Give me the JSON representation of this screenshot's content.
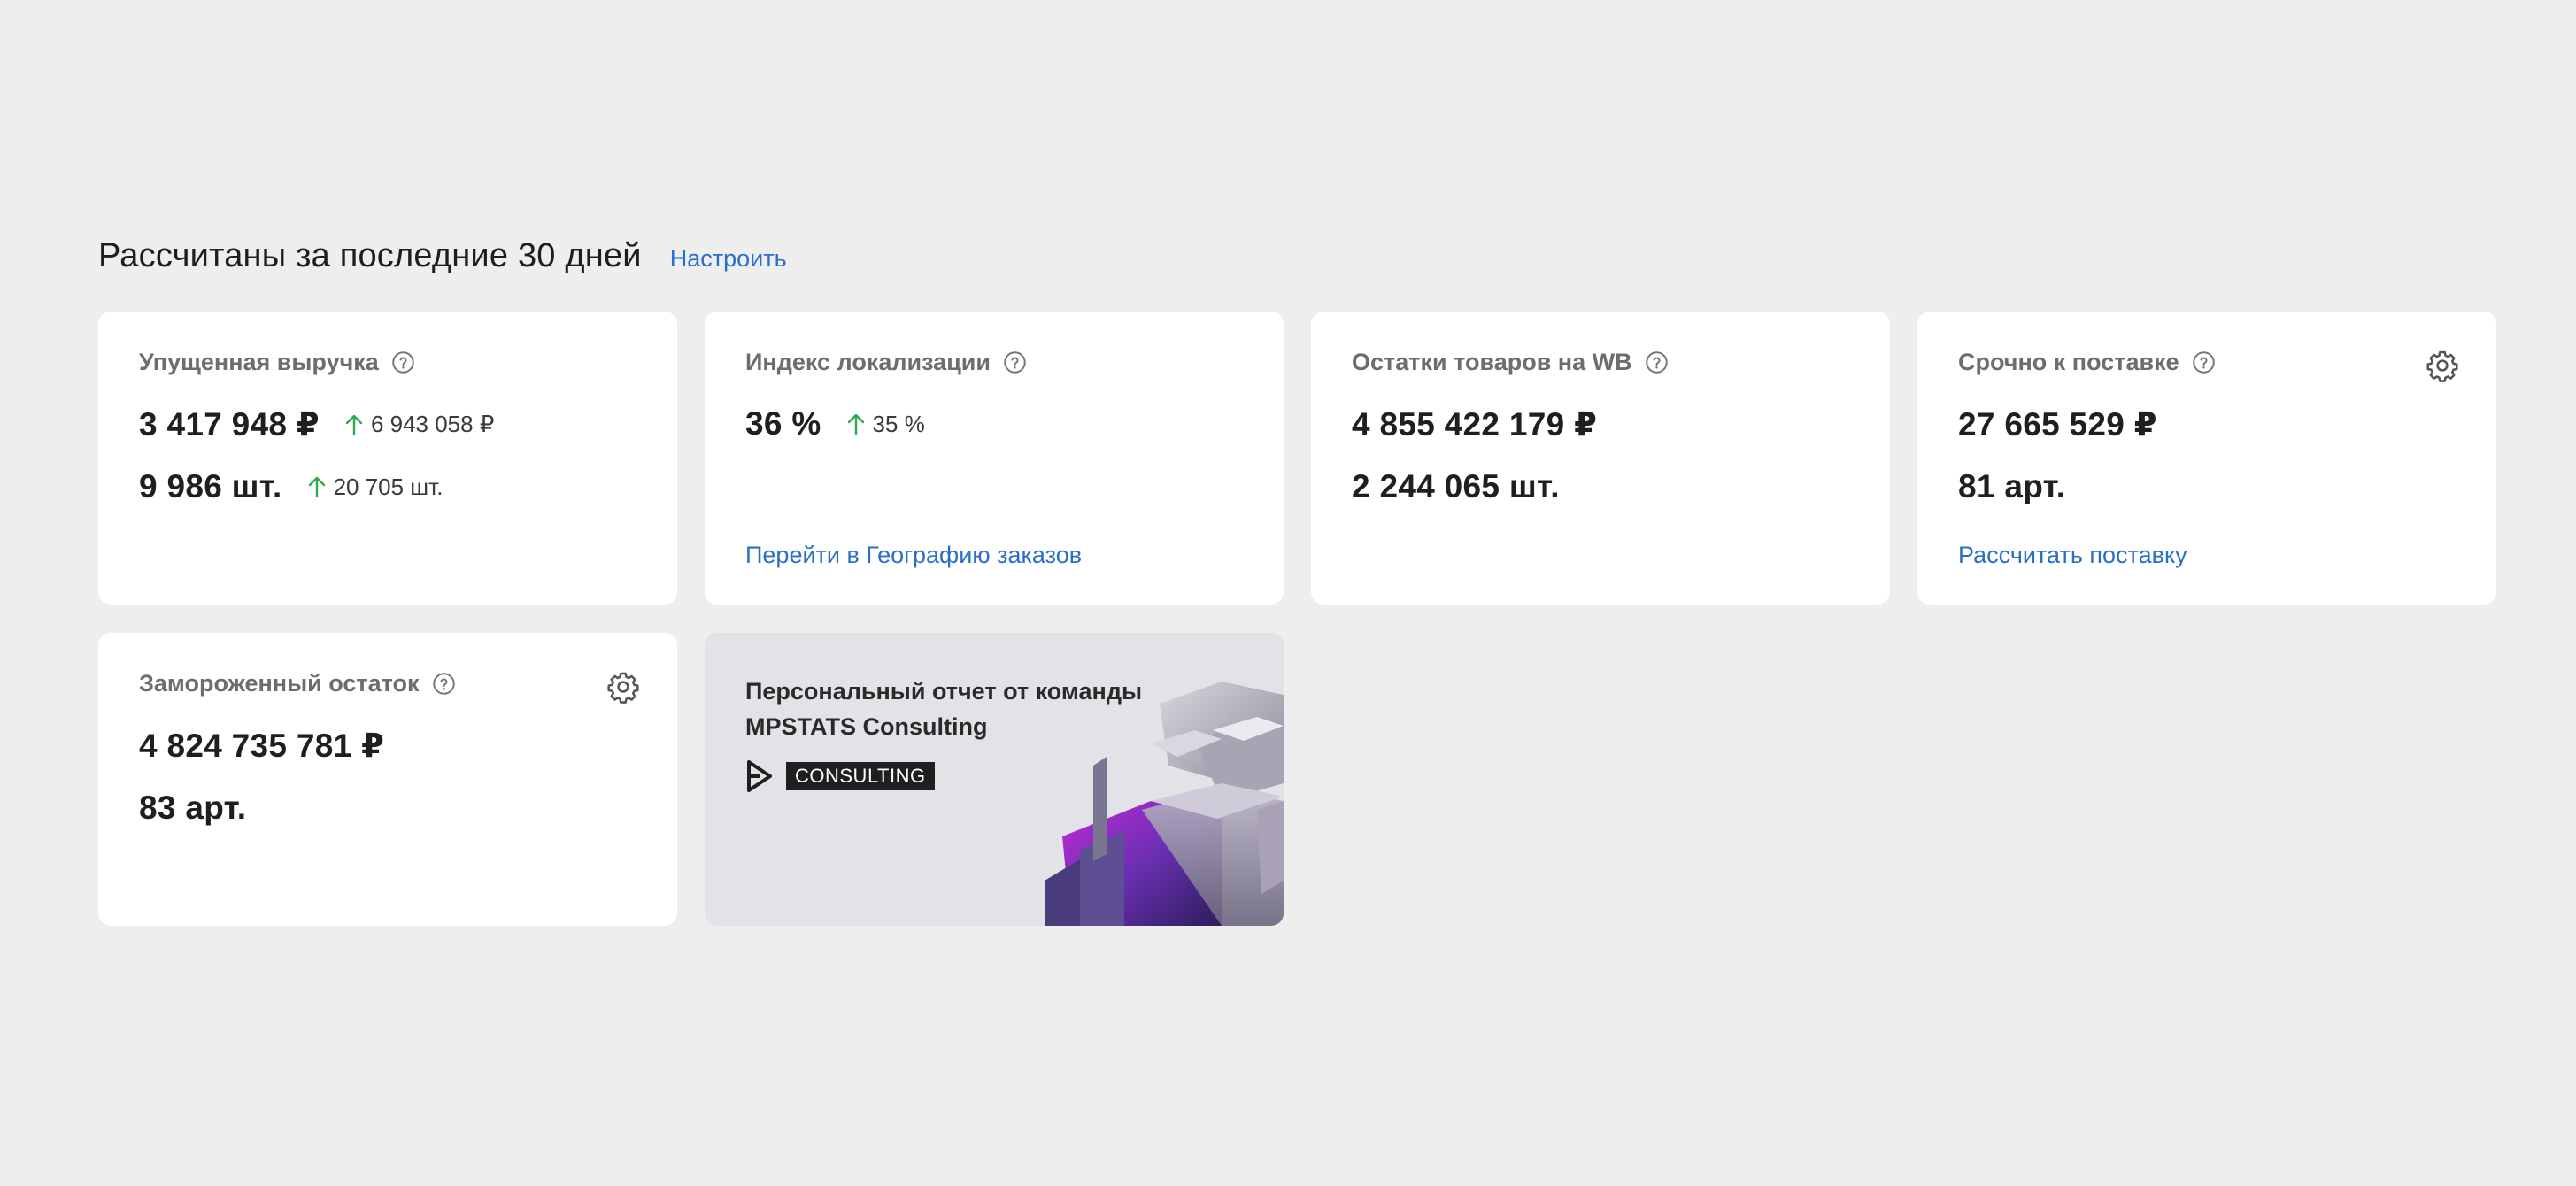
{
  "header": {
    "title": "Рассчитаны за последние 30 дней",
    "configure_link": "Настроить"
  },
  "cards": {
    "lost_revenue": {
      "title": "Упущенная выручка",
      "value_rub": "3 417 948 ₽",
      "delta_rub": "6 943 058 ₽",
      "value_units": "9 986 шт.",
      "delta_units": "20 705 шт.",
      "delta_color": "#2eaa4f"
    },
    "localization_index": {
      "title": "Индекс локализации",
      "value": "36 %",
      "delta": "35 %",
      "link": "Перейти в Географию заказов"
    },
    "wb_stock": {
      "title": "Остатки товаров на WB",
      "value_rub": "4 855 422 179 ₽",
      "value_units": "2 244 065 шт."
    },
    "urgent_supply": {
      "title": "Срочно к поставке",
      "value_rub": "27 665 529 ₽",
      "value_articles": "81 арт.",
      "link": "Рассчитать поставку"
    },
    "frozen_stock": {
      "title": "Замороженный остаток",
      "value_rub": "4 824 735 781 ₽",
      "value_articles": "83 арт."
    },
    "promo": {
      "line1": "Персональный отчет от команды",
      "line2": "MPSTATS Consulting",
      "badge": "CONSULTING"
    }
  },
  "colors": {
    "accent_link": "#2a6fc7",
    "up_arrow": "#2eaa4f",
    "page_bg": "#eeeeee",
    "card_bg": "#ffffff"
  },
  "icons": {
    "help": "question-circle-icon",
    "settings": "gear-icon",
    "trend_up": "arrow-up-icon"
  }
}
